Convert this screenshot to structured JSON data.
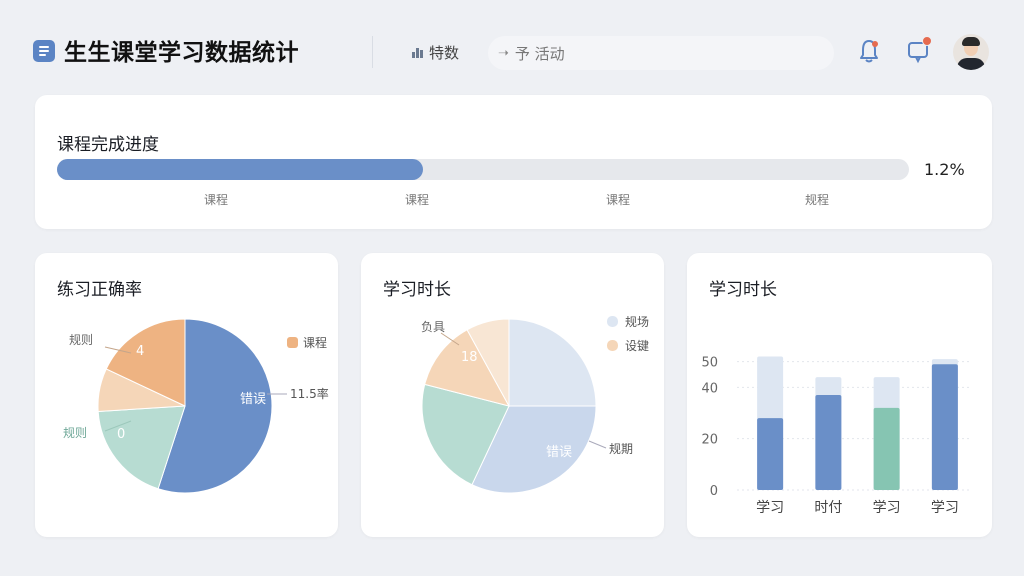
{
  "header": {
    "title": "生生课堂学习数据统计",
    "tab_stats": "特数",
    "tab_activity": "予 活动",
    "icons": [
      "document-icon",
      "bar-chart-icon",
      "arrow-right-icon",
      "bell-icon",
      "message-icon",
      "avatar"
    ]
  },
  "progress": {
    "title": "课程完成进度",
    "percent_label": "1.2%",
    "fill_fraction": 0.43,
    "milestones": [
      "课程",
      "课程",
      "课程",
      "规程"
    ]
  },
  "colors": {
    "blue": "#6a8fc8",
    "orange": "#eeb382",
    "peach": "#f5d6b8",
    "mint": "#b7dcd2",
    "lightblue": "#dde6f2",
    "green": "#86c5b2"
  },
  "chart_data": [
    {
      "type": "pie",
      "title": "练习正确率",
      "slices": [
        {
          "label": "错误",
          "value": 55,
          "color": "#6a8fc8"
        },
        {
          "label": "0",
          "value": 19,
          "color": "#b7dcd2"
        },
        {
          "label": "",
          "value": 8,
          "color": "#f5d6b8"
        },
        {
          "label": "4",
          "value": 18,
          "color": "#eeb382"
        }
      ],
      "callouts": {
        "top_left": "规则",
        "left": "规则",
        "right": "11.5率",
        "inside": "错误"
      },
      "legend": [
        {
          "label": "课程",
          "color": "#eeb382"
        }
      ]
    },
    {
      "type": "pie",
      "title": "学习时长",
      "slices": [
        {
          "label": "",
          "value": 25,
          "color": "#dde6f2"
        },
        {
          "label": "错误",
          "value": 32,
          "color": "#c9d7ec"
        },
        {
          "label": "",
          "value": 22,
          "color": "#b7dcd2"
        },
        {
          "label": "18",
          "value": 13,
          "color": "#f5d6b8"
        },
        {
          "label": "",
          "value": 8,
          "color": "#f8e6d4"
        }
      ],
      "callouts": {
        "top_left": "负具",
        "right": "规期"
      },
      "legend": [
        {
          "label": "规场",
          "color": "#dde6f2"
        },
        {
          "label": "设键",
          "color": "#f5d6b8"
        }
      ]
    },
    {
      "type": "bar",
      "title": "学习时长",
      "categories": [
        "学习",
        "时付",
        "学习",
        "学习"
      ],
      "values": [
        28,
        37,
        32,
        49
      ],
      "totals": [
        52,
        44,
        44,
        51
      ],
      "bar_colors": [
        "#6a8fc8",
        "#6a8fc8",
        "#86c5b2",
        "#6a8fc8"
      ],
      "ylim": [
        0,
        60
      ],
      "yticks": [
        0,
        20,
        40,
        50
      ],
      "grid": true
    }
  ]
}
